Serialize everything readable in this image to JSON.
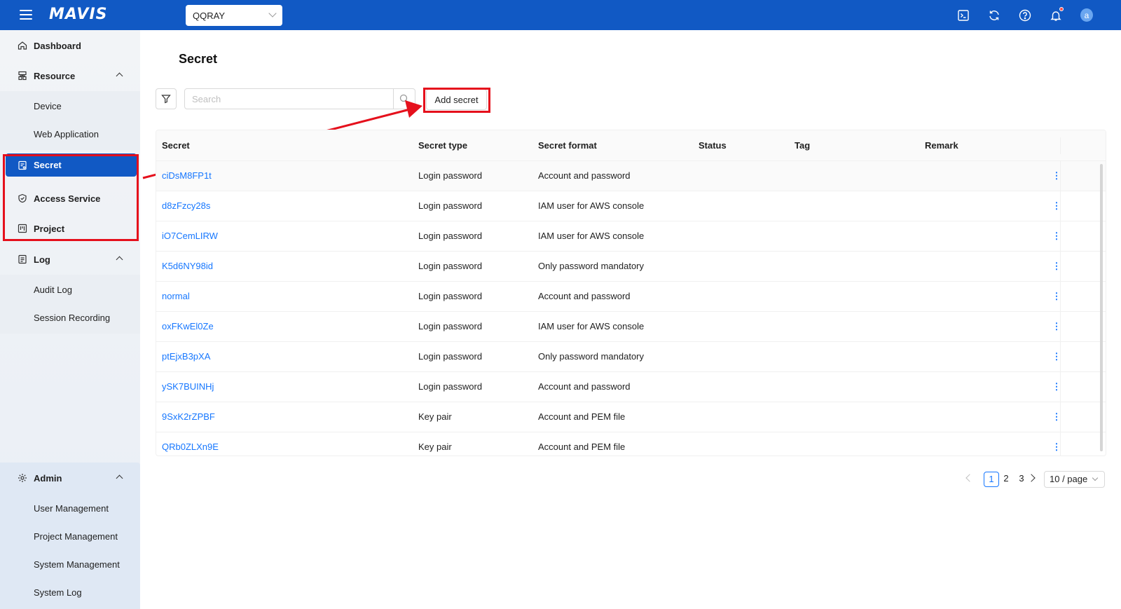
{
  "app": {
    "logo": "MAVIS",
    "project_selected": "QQRAY"
  },
  "topbar_icons": [
    "terminal-icon",
    "refresh-icon",
    "help-icon",
    "bell-icon"
  ],
  "user": {
    "avatar_letter": "a"
  },
  "sidebar": {
    "dashboard": "Dashboard",
    "resource": "Resource",
    "resource_items": [
      "Device",
      "Web Application"
    ],
    "secret": "Secret",
    "access_service": "Access Service",
    "project": "Project",
    "log": "Log",
    "log_items": [
      "Audit Log",
      "Session Recording"
    ],
    "admin": "Admin",
    "admin_items": [
      "User Management",
      "Project Management",
      "System Management",
      "System Log"
    ]
  },
  "page": {
    "title": "Secret",
    "search_placeholder": "Search",
    "add_button": "Add secret"
  },
  "table": {
    "columns": [
      "Secret",
      "Secret type",
      "Secret format",
      "Status",
      "Tag",
      "Remark"
    ],
    "rows": [
      {
        "secret": "ciDsM8FP1t",
        "type": "Login password",
        "format": "Account and password",
        "status": "",
        "tag": "",
        "remark": ""
      },
      {
        "secret": "d8zFzcy28s",
        "type": "Login password",
        "format": "IAM user for AWS console",
        "status": "",
        "tag": "",
        "remark": ""
      },
      {
        "secret": "iO7CemLIRW",
        "type": "Login password",
        "format": "IAM user for AWS console",
        "status": "",
        "tag": "",
        "remark": ""
      },
      {
        "secret": "K5d6NY98id",
        "type": "Login password",
        "format": "Only password mandatory",
        "status": "",
        "tag": "",
        "remark": ""
      },
      {
        "secret": "normal",
        "type": "Login password",
        "format": "Account and password",
        "status": "",
        "tag": "",
        "remark": ""
      },
      {
        "secret": "oxFKwEl0Ze",
        "type": "Login password",
        "format": "IAM user for AWS console",
        "status": "",
        "tag": "",
        "remark": ""
      },
      {
        "secret": "ptEjxB3pXA",
        "type": "Login password",
        "format": "Only password mandatory",
        "status": "",
        "tag": "",
        "remark": ""
      },
      {
        "secret": "ySK7BUINHj",
        "type": "Login password",
        "format": "Account and password",
        "status": "",
        "tag": "",
        "remark": ""
      },
      {
        "secret": "9SxK2rZPBF",
        "type": "Key pair",
        "format": "Account and PEM file",
        "status": "",
        "tag": "",
        "remark": ""
      },
      {
        "secret": "QRb0ZLXn9E",
        "type": "Key pair",
        "format": "Account and PEM file",
        "status": "",
        "tag": "",
        "remark": ""
      }
    ],
    "row_action": "⋮"
  },
  "pagination": {
    "pages": [
      "1",
      "2",
      "3"
    ],
    "current": "1",
    "page_size": "10 / page"
  },
  "annotation_color": "#e5101c",
  "accent_color": "#1159c4",
  "link_color": "#1677ff"
}
